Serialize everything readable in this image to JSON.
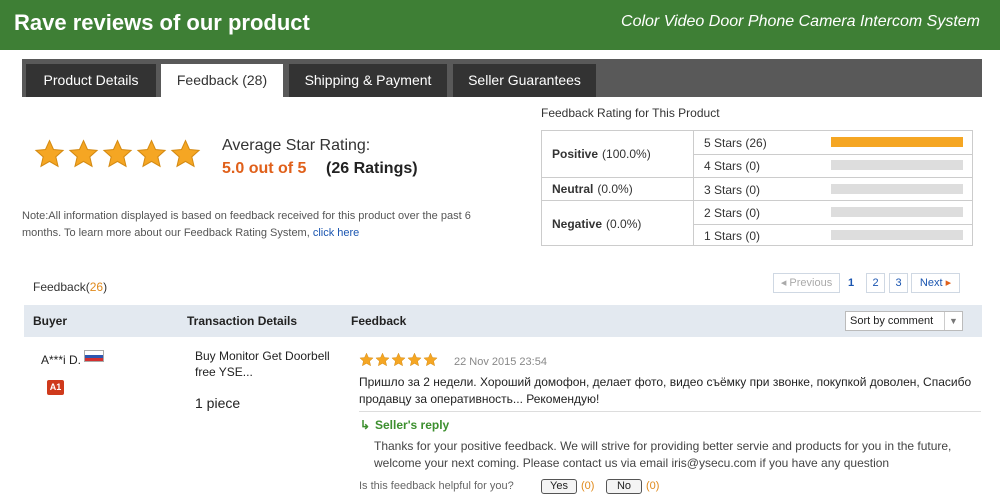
{
  "banner": {
    "title": "Rave reviews of our product",
    "subtitle": "Color Video Door Phone Camera Intercom System"
  },
  "tabs": [
    {
      "label": "Product Details",
      "active": false
    },
    {
      "label": "Feedback (28)",
      "active": true
    },
    {
      "label": "Shipping & Payment",
      "active": false
    },
    {
      "label": "Seller Guarantees",
      "active": false
    }
  ],
  "summary": {
    "stars": 5,
    "avg_label": "Average Star Rating:",
    "avg_value": "5.0 out of 5",
    "rating_count": "(26 Ratings)",
    "note": "Note:All information displayed is based on feedback received for this product over the past 6 months. To learn more about our Feedback Rating System,",
    "note_link": "click here"
  },
  "rating_panel": {
    "title": "Feedback Rating for This Product",
    "groups": {
      "positive": {
        "label": "Positive",
        "pct": "(100.0%)"
      },
      "neutral": {
        "label": "Neutral",
        "pct": "(0.0%)"
      },
      "negative": {
        "label": "Negative",
        "pct": "(0.0%)"
      }
    },
    "rows": [
      {
        "label": "5 Stars (26)",
        "fraction": 1.0
      },
      {
        "label": "4 Stars (0)",
        "fraction": 0
      },
      {
        "label": "3 Stars (0)",
        "fraction": 0
      },
      {
        "label": "2 Stars (0)",
        "fraction": 0
      },
      {
        "label": "1 Stars (0)",
        "fraction": 0
      }
    ]
  },
  "feedback_list": {
    "count_label": "Feedback(",
    "count": "26",
    "count_close": ")",
    "pagination": {
      "previous": "Previous",
      "pages": [
        "1",
        "2",
        "3"
      ],
      "current": "1",
      "next": "Next"
    },
    "columns": {
      "buyer": "Buyer",
      "transaction": "Transaction Details",
      "feedback": "Feedback"
    },
    "sort": "Sort by comment"
  },
  "review": {
    "buyer": "A***i D.",
    "level": "A1",
    "transaction": "Buy Monitor Get Doorbell free YSE...",
    "quantity": "1 piece",
    "stars": 5,
    "date": "22 Nov 2015 23:54",
    "text": "Пришло за 2 недели. Хороший домофон, делает фото, видео съёмку при звонке, покупкой доволен, Спасибо продавцу за оперативность... Рекомендую!",
    "reply_title": "Seller's reply",
    "reply_text": "Thanks for your positive feedback. We will strive for providing better servie and products for you in the future, welcome your next coming. Please contact us via email iris@ysecu.com if you have any question",
    "helpful_label": "Is this feedback helpful for you?",
    "yes_label": "Yes",
    "yes_count": "(0)",
    "no_label": "No",
    "no_count": "(0)"
  },
  "colors": {
    "banner": "#3e7f35",
    "star": "#f5a623",
    "accent_orange": "#e0601a",
    "link": "#1a55b0",
    "reply_green": "#3c8f2e"
  }
}
